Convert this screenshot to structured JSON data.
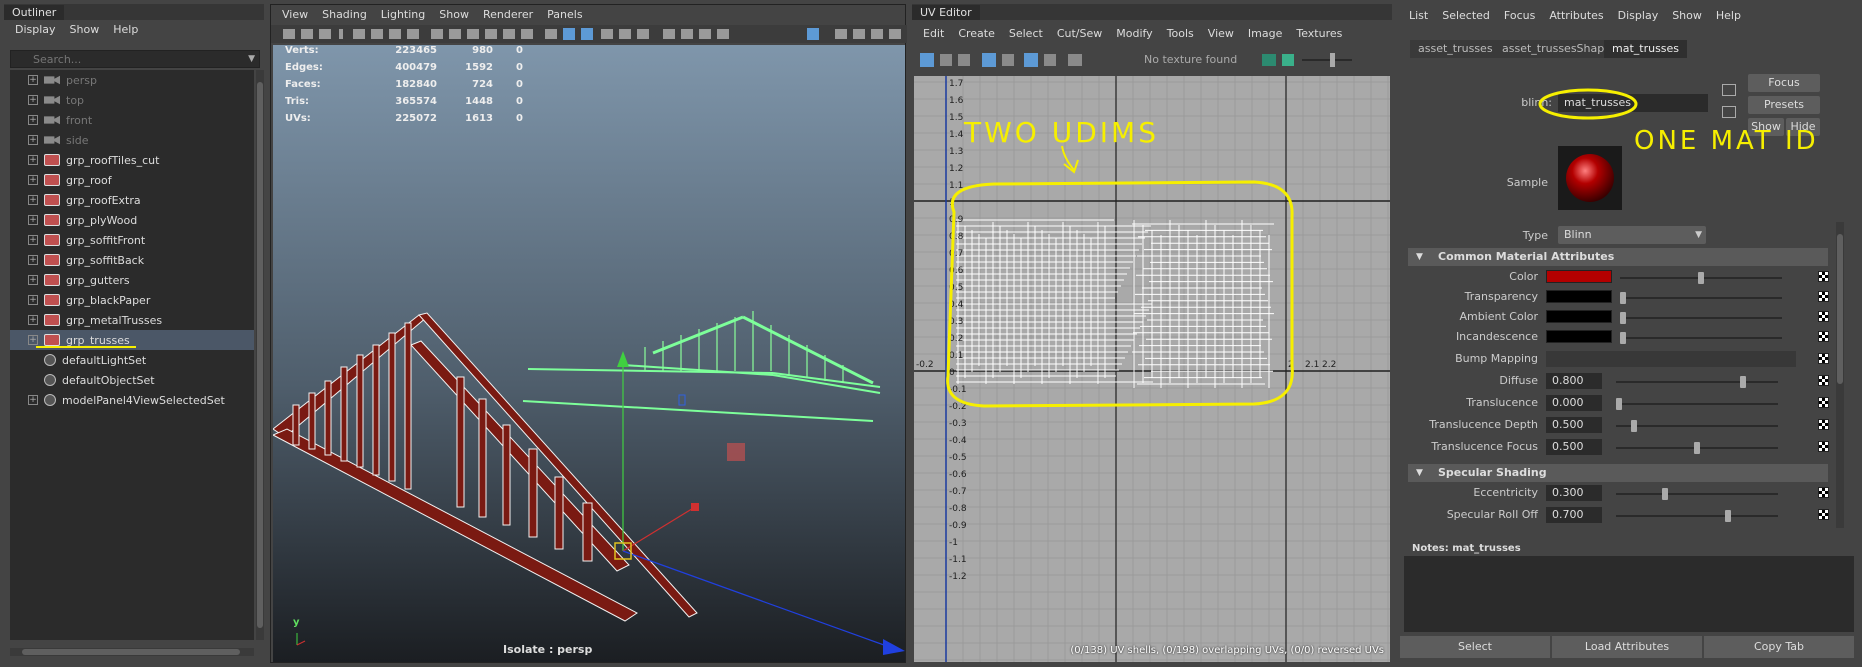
{
  "outliner": {
    "tab": "Outliner",
    "menu": [
      "Display",
      "Show",
      "Help"
    ],
    "search_placeholder": "Search...",
    "items": [
      {
        "label": "persp",
        "icon": "camera-icon",
        "dim": true
      },
      {
        "label": "top",
        "icon": "camera-icon",
        "dim": true
      },
      {
        "label": "front",
        "icon": "camera-icon",
        "dim": true
      },
      {
        "label": "side",
        "icon": "camera-icon",
        "dim": true
      },
      {
        "label": "grp_roofTiles_cut",
        "icon": "group-icon"
      },
      {
        "label": "grp_roof",
        "icon": "group-icon"
      },
      {
        "label": "grp_roofExtra",
        "icon": "group-icon"
      },
      {
        "label": "grp_plyWood",
        "icon": "group-icon"
      },
      {
        "label": "grp_soffitFront",
        "icon": "group-icon"
      },
      {
        "label": "grp_soffitBack",
        "icon": "group-icon"
      },
      {
        "label": "grp_gutters",
        "icon": "group-icon"
      },
      {
        "label": "grp_blackPaper",
        "icon": "group-icon"
      },
      {
        "label": "grp_metalTrusses",
        "icon": "group-icon"
      },
      {
        "label": "grp_trusses",
        "icon": "group-icon",
        "selected": true
      },
      {
        "label": "defaultLightSet",
        "icon": "set-icon"
      },
      {
        "label": "defaultObjectSet",
        "icon": "set-icon"
      },
      {
        "label": "modelPanel4ViewSelectedSet",
        "icon": "set-icon"
      }
    ]
  },
  "viewport": {
    "menu": [
      "View",
      "Shading",
      "Lighting",
      "Show",
      "Renderer",
      "Panels"
    ],
    "stats": [
      {
        "label": "Verts:",
        "a": "223465",
        "b": "980",
        "c": "0"
      },
      {
        "label": "Edges:",
        "a": "400479",
        "b": "1592",
        "c": "0"
      },
      {
        "label": "Faces:",
        "a": "182840",
        "b": "724",
        "c": "0"
      },
      {
        "label": "Tris:",
        "a": "365574",
        "b": "1448",
        "c": "0"
      },
      {
        "label": "UVs:",
        "a": "225072",
        "b": "1613",
        "c": "0"
      }
    ],
    "isolate_label": "Isolate : persp",
    "axis_y": "y",
    "axis_x": "x"
  },
  "uv_editor": {
    "tab": "UV Editor",
    "menu": [
      "Edit",
      "Create",
      "Select",
      "Cut/Sew",
      "Modify",
      "Tools",
      "View",
      "Image",
      "Textures"
    ],
    "texture_status": "No texture found",
    "y_ticks": [
      "1.7",
      "1.6",
      "1.5",
      "1.4",
      "1.3",
      "1.2",
      "1.1",
      "1",
      "0.9",
      "0.8",
      "0.7",
      "0.6",
      "0.5",
      "0.4",
      "0.3",
      "0.2",
      "0.1",
      "0",
      "-0.1",
      "-0.2",
      "-0.3",
      "-0.4",
      "-0.5",
      "-0.6",
      "-0.7",
      "-0.8",
      "-0.9",
      "-1",
      "-1.1",
      "-1.2"
    ],
    "x_ticks_left": "-0.2",
    "x_ticks_right": [
      "2",
      "2.1",
      "2.2"
    ],
    "status": "(0/138) UV shells, (0/198) overlapping UVs, (0/0) reversed UVs",
    "annotation_title": "TWO UDIMS"
  },
  "attribute_editor": {
    "menu": [
      "List",
      "Selected",
      "Focus",
      "Attributes",
      "Display",
      "Show",
      "Help"
    ],
    "tabs": [
      "asset_trusses",
      "asset_trussesShape",
      "mat_trusses"
    ],
    "name_label": "blinn:",
    "name_value": "mat_trusses",
    "focus_btn": "Focus",
    "presets_btn": "Presets",
    "show_btn": "Show",
    "hide_btn": "Hide",
    "sample_label": "Sample",
    "type_label": "Type",
    "type_value": "Blinn",
    "annotation": "ONE MAT ID",
    "section_common": "Common Material Attributes",
    "section_specular": "Specular Shading",
    "attrs": [
      {
        "label": "Color",
        "swatch": "#b30000",
        "level": 0.5
      },
      {
        "label": "Transparency",
        "swatch": "#000000",
        "level": 0
      },
      {
        "label": "Ambient Color",
        "swatch": "#000000",
        "level": 0
      },
      {
        "label": "Incandescence",
        "swatch": "#000000",
        "level": 0
      },
      {
        "label": "Bump Mapping"
      },
      {
        "label": "Diffuse",
        "value": "0.800",
        "level": 0.8
      },
      {
        "label": "Translucence",
        "value": "0.000",
        "level": 0
      },
      {
        "label": "Translucence Depth",
        "value": "0.500",
        "level": 0.1
      },
      {
        "label": "Translucence Focus",
        "value": "0.500",
        "level": 0.5
      }
    ],
    "spec_attrs": [
      {
        "label": "Eccentricity",
        "value": "0.300",
        "level": 0.3
      },
      {
        "label": "Specular Roll Off",
        "value": "0.700",
        "level": 0.7
      }
    ],
    "notes_label": "Notes:  mat_trusses",
    "bottom_buttons": [
      "Select",
      "Load Attributes",
      "Copy Tab"
    ]
  },
  "colors": {
    "annotation": "#f6ef00",
    "truss": "#7a1a12",
    "selection": "#4b5767"
  }
}
